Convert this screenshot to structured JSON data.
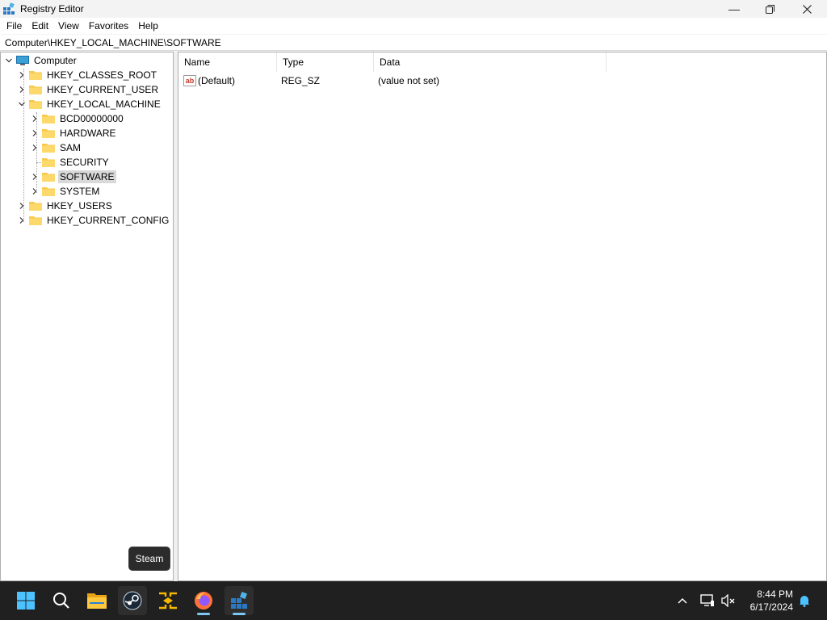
{
  "window": {
    "title": "Registry Editor",
    "minimize_icon": "minimize-icon",
    "maximize_icon": "maximize-icon",
    "close_icon": "close-icon"
  },
  "menu": [
    "File",
    "Edit",
    "View",
    "Favorites",
    "Help"
  ],
  "address": "Computer\\HKEY_LOCAL_MACHINE\\SOFTWARE",
  "tree": {
    "root": "Computer",
    "hives": {
      "classes_root": "HKEY_CLASSES_ROOT",
      "current_user": "HKEY_CURRENT_USER",
      "local_machine": "HKEY_LOCAL_MACHINE",
      "users": "HKEY_USERS",
      "current_config": "HKEY_CURRENT_CONFIG"
    },
    "local_machine_children": {
      "bcd": "BCD00000000",
      "hardware": "HARDWARE",
      "sam": "SAM",
      "security": "SECURITY",
      "software": "SOFTWARE",
      "system": "SYSTEM"
    },
    "selected": "SOFTWARE"
  },
  "list": {
    "columns": {
      "name": "Name",
      "type": "Type",
      "data": "Data"
    },
    "rows": [
      {
        "icon": "string-value-icon",
        "icon_text": "ab",
        "name": "(Default)",
        "type": "REG_SZ",
        "data": "(value not set)"
      }
    ]
  },
  "taskbar": {
    "apps": [
      "start-icon",
      "search-icon",
      "file-explorer-icon",
      "steam-icon",
      "network-app-icon",
      "firefox-icon",
      "registry-editor-icon"
    ],
    "tooltip": "Steam",
    "time": "8:44 PM",
    "date": "6/17/2024"
  },
  "colors": {
    "selection": "#d9d9d9",
    "folder": "#f8c84a",
    "taskbar": "#202020",
    "accent": "#0078d4"
  }
}
